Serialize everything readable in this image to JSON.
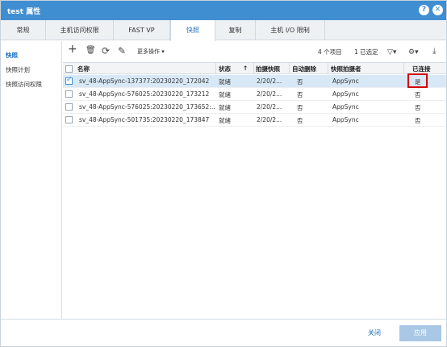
{
  "window": {
    "title": "test 属性",
    "help_icon": "?",
    "close_icon": "✕"
  },
  "tabs": [
    "常规",
    "主机访问权限",
    "FAST VP",
    "快照",
    "复制",
    "主机 I/O 限制"
  ],
  "active_tab": "快照",
  "sidebar": {
    "items": [
      "快照",
      "快照计划",
      "快照访问权限"
    ],
    "active": "快照"
  },
  "toolbar": {
    "add_icon": "+",
    "delete_icon": "🗑",
    "refresh_icon": "⟳",
    "edit_icon": "✎",
    "more_actions": "更多操作 ▾",
    "item_count": "4 个项目",
    "selected_count": "1 已选定",
    "filter_icon": "▽▾",
    "settings_icon": "⚙▾",
    "download_icon": "⤓"
  },
  "table": {
    "headers": {
      "name": "名称",
      "status": "状态",
      "sort_icon": "↑",
      "taken": "拍摄快照",
      "auto_delete": "自动删除",
      "taker": "快照拍摄者",
      "attached": "已连接"
    },
    "rows": [
      {
        "name": "sv_48-AppSync-137377:20230220_172042",
        "status": "就绪",
        "taken": "2/20/2...",
        "auto_delete": "否",
        "taker": "AppSync",
        "attached": "是",
        "selected": true
      },
      {
        "name": "sv_48-AppSync-576025:20230220_173212",
        "status": "就绪",
        "taken": "2/20/2...",
        "auto_delete": "否",
        "taker": "AppSync",
        "attached": "否",
        "selected": false
      },
      {
        "name": "sv_48-AppSync-576025:20230220_173652:...",
        "status": "就绪",
        "taken": "2/20/2...",
        "auto_delete": "否",
        "taker": "AppSync",
        "attached": "否",
        "selected": false
      },
      {
        "name": "sv_48-AppSync-501735:20230220_173847",
        "status": "就绪",
        "taken": "2/20/2...",
        "auto_delete": "否",
        "taker": "AppSync",
        "attached": "否",
        "selected": false
      }
    ]
  },
  "footer": {
    "close": "关闭",
    "apply": "应用"
  },
  "colors": {
    "titlebar": "#3f8ed2",
    "accent": "#1b6fbf",
    "selected_row": "#d8e8f7",
    "highlight": "#d40000"
  }
}
